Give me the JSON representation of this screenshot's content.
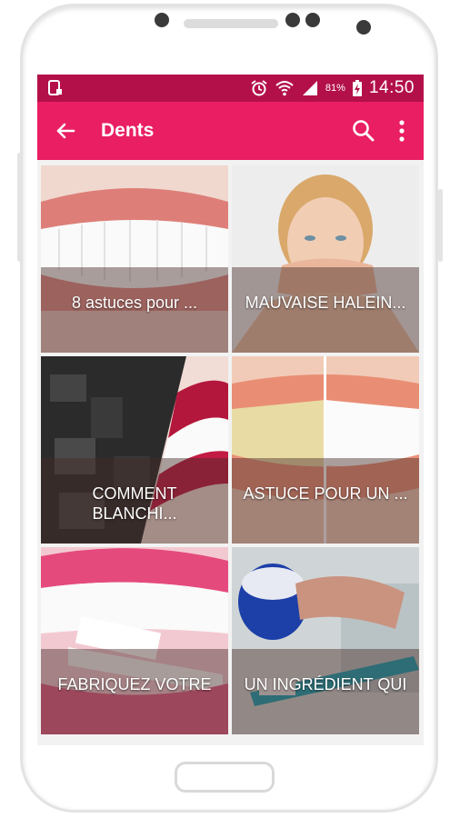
{
  "status_bar": {
    "battery": "81%",
    "time": "14:50"
  },
  "app_bar": {
    "title": "Dents",
    "back_icon": "arrow-back-icon",
    "search_icon": "search-icon",
    "more_icon": "more-vertical-icon"
  },
  "colors": {
    "status_bar": "#b3104a",
    "app_bar": "#e91e63"
  },
  "articles": [
    {
      "caption": "8 astuces pour ..."
    },
    {
      "caption": "MAUVAISE HALEIN..."
    },
    {
      "caption": "COMMENT BLANCHI..."
    },
    {
      "caption": "ASTUCE POUR UN ..."
    },
    {
      "caption": "FABRIQUEZ VOTRE"
    },
    {
      "caption": "UN INGRÉDIENT QUI"
    }
  ]
}
